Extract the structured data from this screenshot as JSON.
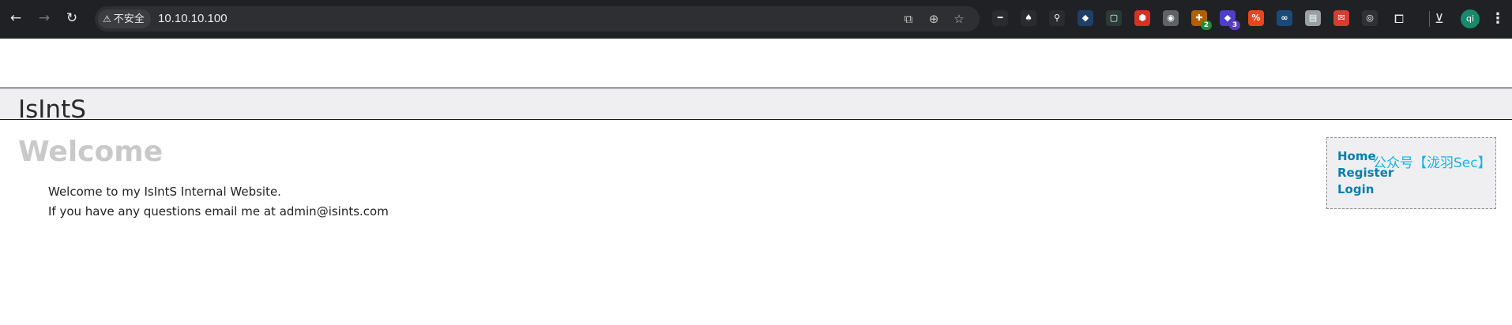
{
  "browser": {
    "security_label": "不安全",
    "url": "10.10.10.100",
    "extensions": [
      {
        "name": "ext-1",
        "glyph": "━",
        "color": "#2a2b2e"
      },
      {
        "name": "ext-2",
        "glyph": "♠",
        "color": "#2a2b2e"
      },
      {
        "name": "ext-3",
        "glyph": "⚲",
        "color": "#2a2b2e"
      },
      {
        "name": "ext-4",
        "glyph": "◆",
        "color": "#1f3f66"
      },
      {
        "name": "ext-5",
        "glyph": "▢",
        "color": "#2b3a36"
      },
      {
        "name": "ext-6",
        "glyph": "⬢",
        "color": "#d93025"
      },
      {
        "name": "ext-7",
        "glyph": "◉",
        "color": "#5f6368"
      },
      {
        "name": "ext-8",
        "glyph": "✚",
        "color": "#b06000",
        "badge": "2",
        "badge_color": "#1e8e3e"
      },
      {
        "name": "ext-9",
        "glyph": "◆",
        "color": "#4f3ec9",
        "badge": "3",
        "badge_color": "#5b3cc4"
      },
      {
        "name": "ext-10",
        "glyph": "%",
        "color": "#e8471c"
      },
      {
        "name": "ext-11",
        "glyph": "∞",
        "color": "#1a4a7a"
      },
      {
        "name": "ext-12",
        "glyph": "▤",
        "color": "#9aa0a6"
      },
      {
        "name": "ext-13",
        "glyph": "✉",
        "color": "#d23f31"
      },
      {
        "name": "ext-14",
        "glyph": "◎",
        "color": "#303134"
      }
    ],
    "profile_initials": "qi"
  },
  "site": {
    "title": "IsIntS",
    "heading": "Welcome",
    "welcome_line": "Welcome to my IsIntS Internal Website.",
    "email_line": "If you have any questions email me at admin@isints.com",
    "nav": {
      "home": "Home",
      "register": "Register",
      "login": "Login"
    },
    "watermark": "公众号【泷羽Sec】"
  },
  "colors": {
    "header_bg": "#efeef1",
    "heading_color": "#c9c9c9",
    "link_color": "#0a7fb0",
    "watermark_color": "#12b5e6"
  }
}
